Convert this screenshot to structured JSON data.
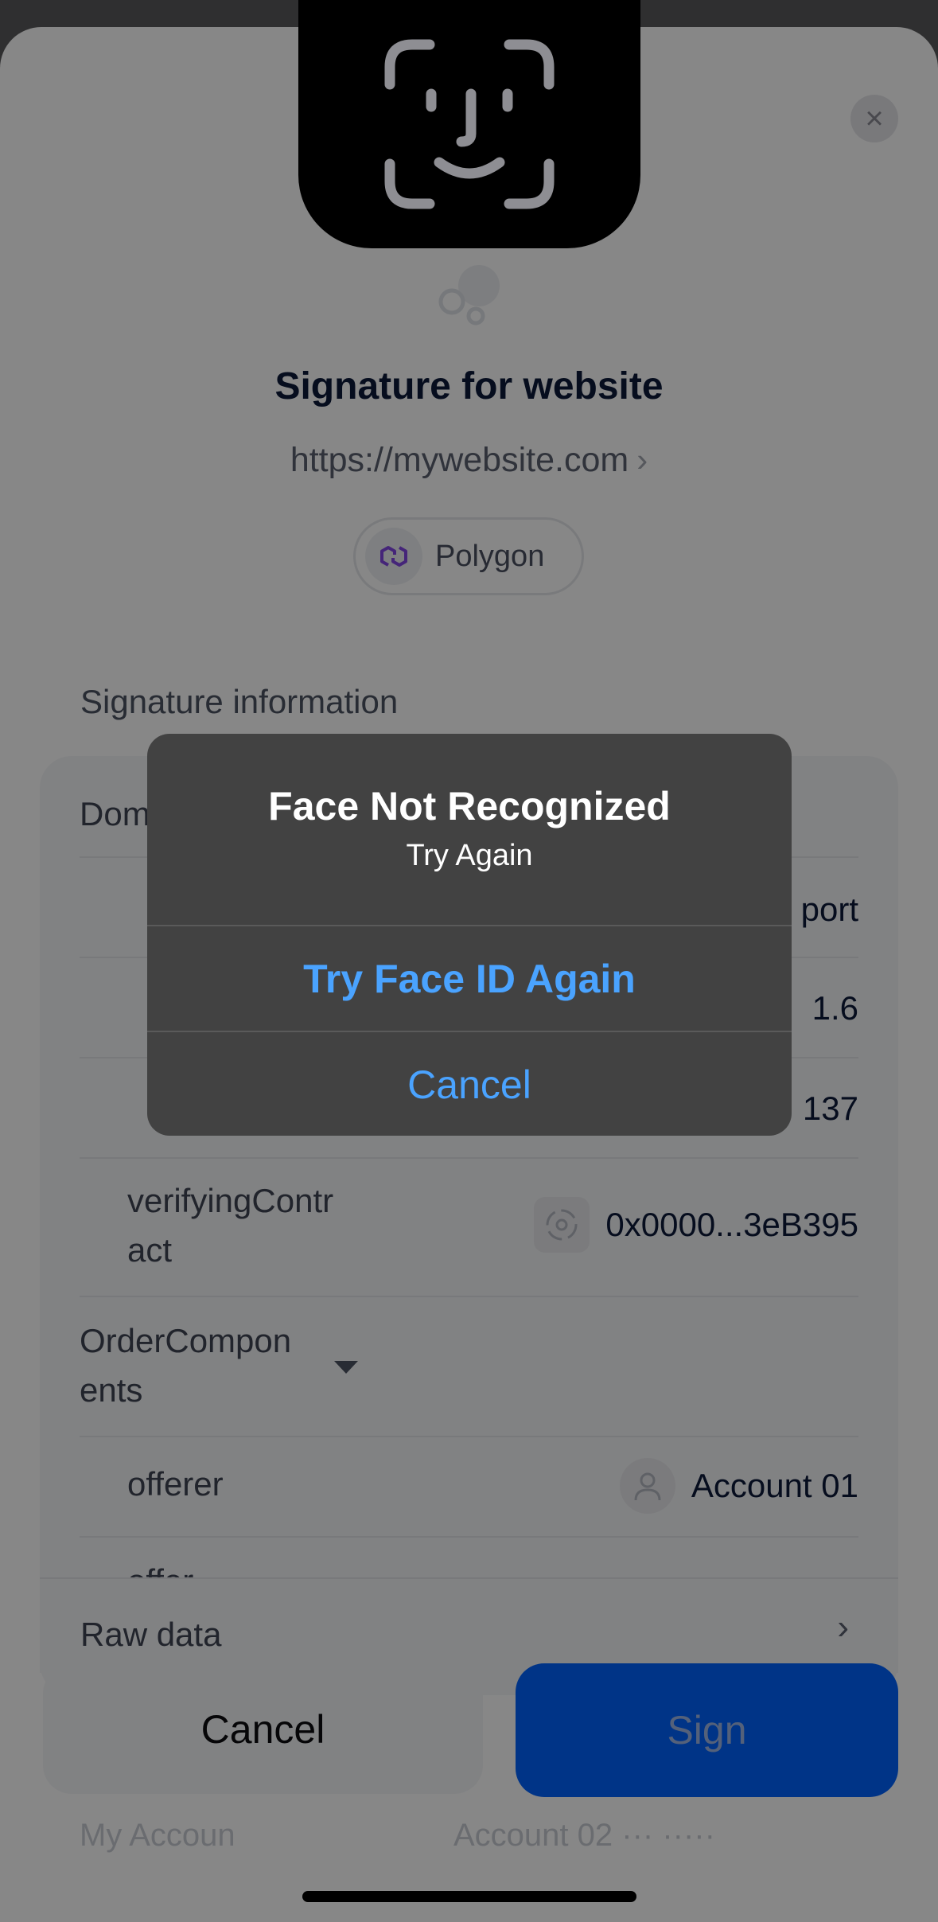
{
  "sheet": {
    "title": "Signature for website",
    "url": "https://mywebsite.com",
    "network": "Polygon",
    "section_title": "Signature information",
    "rows": {
      "domain_label": "Dom",
      "name_value": "port",
      "version_value": "1.6",
      "chain_value": "137",
      "verifying_label": "verifyingContr\nact",
      "verifying_value": "0x0000...3eB395",
      "order_label": "OrderCompon\nents",
      "offerer_label": "offerer",
      "offerer_value": "Account 01",
      "offer_label": "offer"
    },
    "raw_data_label": "Raw data",
    "peek_left": "My Accoun",
    "peek_right": "Account 02 ··· ·····",
    "cancel_label": "Cancel",
    "sign_label": "Sign"
  },
  "alert": {
    "title": "Face Not Recognized",
    "message": "Try Again",
    "primary_button": "Try Face ID Again",
    "secondary_button": "Cancel"
  },
  "colors": {
    "accent": "#0062ff",
    "alert_bg": "#424242",
    "alert_button": "#4aa3ff"
  },
  "icons": [
    "close-icon",
    "chevron-right-icon",
    "polygon-icon",
    "contract-icon",
    "account-icon",
    "caret-down-icon",
    "face-id-icon"
  ]
}
